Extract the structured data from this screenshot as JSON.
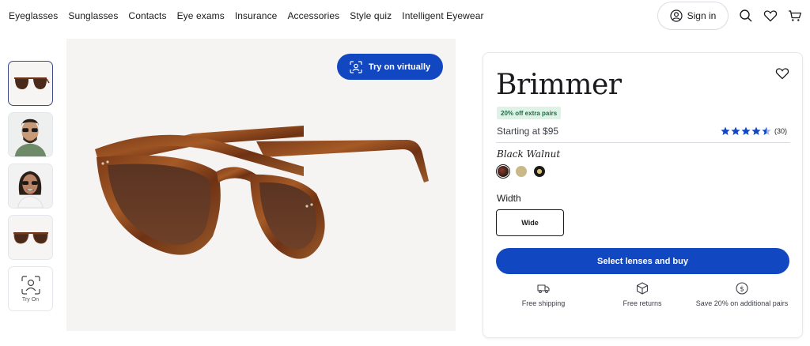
{
  "nav": {
    "links": [
      "Eyeglasses",
      "Sunglasses",
      "Contacts",
      "Eye exams",
      "Insurance",
      "Accessories",
      "Style quiz",
      "Intelligent Eyewear"
    ],
    "sign_in": "Sign in",
    "icons": [
      "search-icon",
      "heart-icon",
      "cart-icon"
    ]
  },
  "thumbnails": {
    "items": [
      "sunglasses-angle",
      "male-model",
      "female-model",
      "sunglasses-front"
    ],
    "try_on_label": "Try On"
  },
  "hero": {
    "try_on_button": "Try on virtually"
  },
  "product": {
    "name": "Brimmer",
    "promo_badge": "20% off extra pairs",
    "price_text": "Starting at $95",
    "rating": 4.5,
    "rating_count": "(30)",
    "color_name": "Black Walnut",
    "swatches": [
      {
        "name": "Black Walnut",
        "color": "#4a2e22",
        "selected": true
      },
      {
        "name": "Tan",
        "color": "#c9b988",
        "selected": false
      },
      {
        "name": "Black Gold",
        "color": "#1a1a1a",
        "selected": false
      }
    ],
    "width_label": "Width",
    "width_option": "Wide",
    "buy_button": "Select lenses and buy",
    "perks": [
      {
        "icon": "truck-icon",
        "text": "Free shipping"
      },
      {
        "icon": "box-icon",
        "text": "Free returns"
      },
      {
        "icon": "dollar-icon",
        "text": "Save 20% on additional pairs"
      }
    ]
  },
  "colors": {
    "accent": "#1247c2",
    "promo_bg": "#dff2e7",
    "promo_text": "#1f6b45",
    "star": "#1247c2"
  }
}
